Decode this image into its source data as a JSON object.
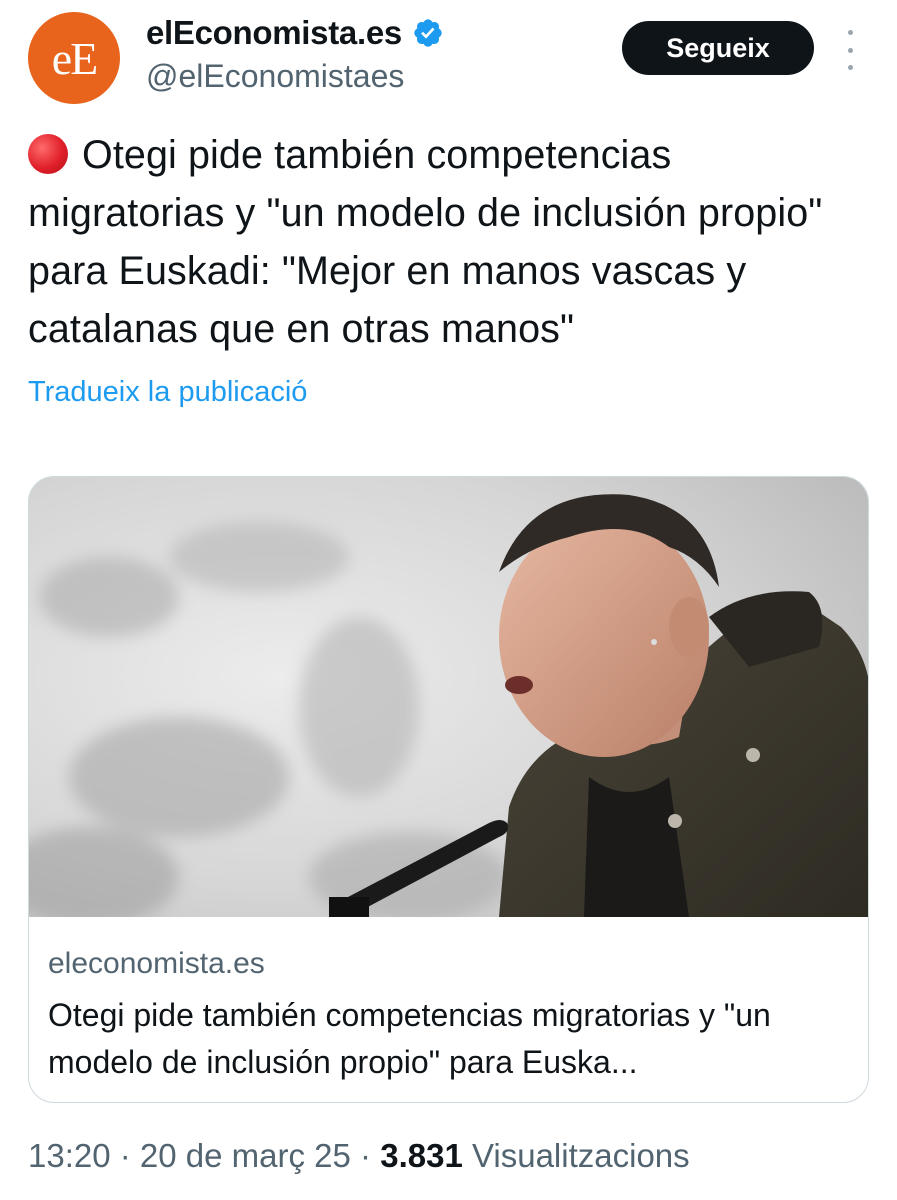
{
  "header": {
    "avatar_text": "eE",
    "display_name": "elEconomista.es",
    "verified_icon": "verified-badge-icon",
    "handle": "@elEconomistaes",
    "follow_label": "Segueix",
    "more_icon": "more-vertical-icon",
    "avatar_color": "#e8641c",
    "verified_color": "#1d9bf0"
  },
  "tweet": {
    "emoji_icon": "red-circle-icon",
    "text": "Otegi pide también competencias migratorias y \"un modelo de inclusión propio\" para Euskadi: \"Mejor en manos vascas y catalanas que en otras manos\"",
    "translate_label": "Tradueix la publicació"
  },
  "card": {
    "image": "photo-of-speaker-at-microphone",
    "domain": "eleconomista.es",
    "title": "Otegi pide también competencias migratorias y \"un modelo de inclusión propio\" para Euska..."
  },
  "meta": {
    "time": "13:20",
    "sep1": " · ",
    "date": "20 de març 25",
    "sep2": " · ",
    "views_count": "3.831",
    "views_label": "Visualitzacions"
  },
  "colors": {
    "link": "#1d9bf0",
    "secondary_text": "#536471",
    "primary_text": "#0f1419",
    "button_bg": "#0f1419"
  }
}
